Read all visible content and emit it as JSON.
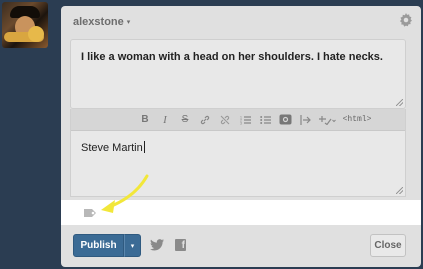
{
  "header": {
    "username": "alexstone",
    "caret": "▾"
  },
  "post": {
    "title": "I like a woman with a head on her shoulders. I hate necks.",
    "body": "Steve Martin"
  },
  "toolbar": {
    "bold": "B",
    "italic": "I",
    "strike": "S",
    "html_label": "<html>"
  },
  "footer": {
    "publish_label": "Publish",
    "publish_dropdown": "▾",
    "close_label": "Close",
    "facebook_glyph": "f"
  },
  "colors": {
    "publish": "#3b6b95",
    "arrow": "#f2e73a",
    "background": "#2b3d52"
  },
  "icons": [
    "gear-icon",
    "link-icon",
    "unlink-icon",
    "numbered-list-icon",
    "bulleted-list-icon",
    "image-icon",
    "read-more-icon",
    "spellcheck-icon",
    "tag-icon",
    "twitter-icon",
    "facebook-icon"
  ]
}
